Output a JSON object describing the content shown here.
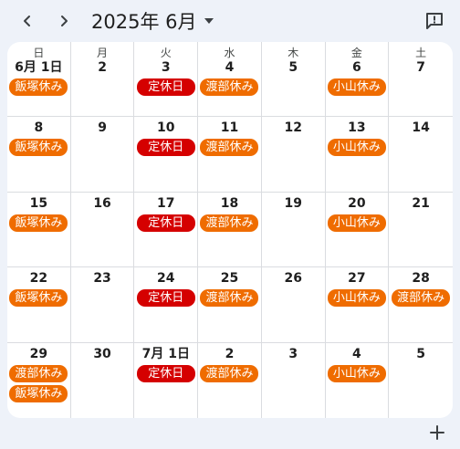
{
  "header": {
    "month_title": "2025年 6月",
    "prev_label": "‹",
    "next_label": "›"
  },
  "weekdays": [
    "日",
    "月",
    "火",
    "水",
    "木",
    "金",
    "土"
  ],
  "event_colors": {
    "orange": "#ef6c00",
    "red": "#d50000"
  },
  "weeks": [
    [
      {
        "day": "6月 1日",
        "events": [
          {
            "title": "飯塚休み",
            "color": "orange"
          }
        ]
      },
      {
        "day": "2",
        "events": []
      },
      {
        "day": "3",
        "events": [
          {
            "title": "定休日",
            "color": "red"
          }
        ]
      },
      {
        "day": "4",
        "events": [
          {
            "title": "渡部休み",
            "color": "orange"
          }
        ]
      },
      {
        "day": "5",
        "events": []
      },
      {
        "day": "6",
        "events": [
          {
            "title": "小山休み",
            "color": "orange"
          }
        ]
      },
      {
        "day": "7",
        "events": []
      }
    ],
    [
      {
        "day": "8",
        "events": [
          {
            "title": "飯塚休み",
            "color": "orange"
          }
        ]
      },
      {
        "day": "9",
        "events": []
      },
      {
        "day": "10",
        "events": [
          {
            "title": "定休日",
            "color": "red"
          }
        ]
      },
      {
        "day": "11",
        "events": [
          {
            "title": "渡部休み",
            "color": "orange"
          }
        ]
      },
      {
        "day": "12",
        "events": []
      },
      {
        "day": "13",
        "events": [
          {
            "title": "小山休み",
            "color": "orange"
          }
        ]
      },
      {
        "day": "14",
        "events": []
      }
    ],
    [
      {
        "day": "15",
        "events": [
          {
            "title": "飯塚休み",
            "color": "orange"
          }
        ]
      },
      {
        "day": "16",
        "events": []
      },
      {
        "day": "17",
        "events": [
          {
            "title": "定休日",
            "color": "red"
          }
        ]
      },
      {
        "day": "18",
        "events": [
          {
            "title": "渡部休み",
            "color": "orange"
          }
        ]
      },
      {
        "day": "19",
        "events": []
      },
      {
        "day": "20",
        "events": [
          {
            "title": "小山休み",
            "color": "orange"
          }
        ]
      },
      {
        "day": "21",
        "events": []
      }
    ],
    [
      {
        "day": "22",
        "events": [
          {
            "title": "飯塚休み",
            "color": "orange"
          }
        ]
      },
      {
        "day": "23",
        "events": []
      },
      {
        "day": "24",
        "events": [
          {
            "title": "定休日",
            "color": "red"
          }
        ]
      },
      {
        "day": "25",
        "events": [
          {
            "title": "渡部休み",
            "color": "orange"
          }
        ]
      },
      {
        "day": "26",
        "events": []
      },
      {
        "day": "27",
        "events": [
          {
            "title": "小山休み",
            "color": "orange"
          }
        ]
      },
      {
        "day": "28",
        "events": [
          {
            "title": "渡部休み",
            "color": "orange"
          }
        ]
      }
    ],
    [
      {
        "day": "29",
        "events": [
          {
            "title": "渡部休み",
            "color": "orange"
          },
          {
            "title": "飯塚休み",
            "color": "orange"
          }
        ]
      },
      {
        "day": "30",
        "events": []
      },
      {
        "day": "7月 1日",
        "events": [
          {
            "title": "定休日",
            "color": "red"
          }
        ]
      },
      {
        "day": "2",
        "events": [
          {
            "title": "渡部休み",
            "color": "orange"
          }
        ]
      },
      {
        "day": "3",
        "events": []
      },
      {
        "day": "4",
        "events": [
          {
            "title": "小山休み",
            "color": "orange"
          }
        ]
      },
      {
        "day": "5",
        "events": []
      }
    ]
  ],
  "icons": {
    "prev": "chevron-left-icon",
    "next": "chevron-right-icon",
    "dropdown": "caret-down-icon",
    "feedback": "feedback-icon",
    "add": "plus-icon"
  }
}
